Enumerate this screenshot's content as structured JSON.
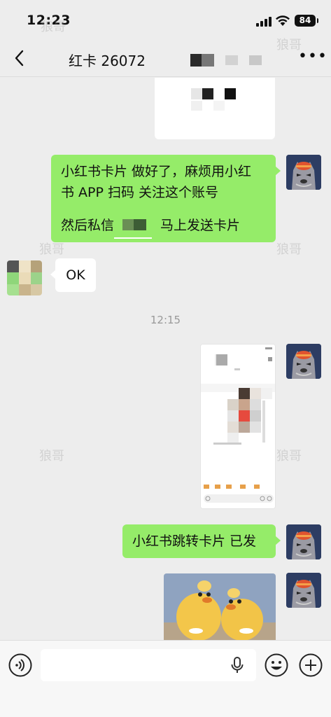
{
  "status": {
    "time": "12:23",
    "battery": "84"
  },
  "nav": {
    "back_icon": "chevron-left-icon",
    "title": "红卡 26072",
    "more_icon": "more-dots-icon"
  },
  "watermark": "狼哥",
  "messages": {
    "m1_line1": "小红书卡片 做好了，麻烦用小红",
    "m1_line2": "书 APP 扫码 关注这个账号",
    "m1_line3a": "然后私信",
    "m1_line3b": "马上发送卡片",
    "m2": "OK",
    "timestamp": "12:15",
    "m3": "小红书跳转卡片 已发"
  },
  "composer": {
    "voice_icon": "voice-icon",
    "mic_icon": "microphone-icon",
    "emoji_icon": "emoji-icon",
    "plus_icon": "plus-icon"
  },
  "colors": {
    "bg": "#ededed",
    "bubble_green": "#95ec69",
    "bubble_white": "#ffffff"
  }
}
